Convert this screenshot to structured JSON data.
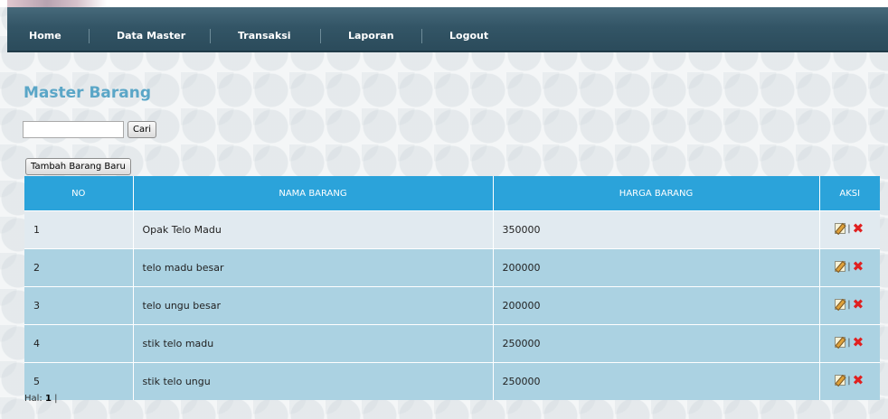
{
  "nav": {
    "items": [
      "Home",
      "Data Master",
      "Transaksi",
      "Laporan",
      "Logout"
    ]
  },
  "page": {
    "title": "Master Barang"
  },
  "search": {
    "value": "",
    "placeholder": "",
    "button": "Cari"
  },
  "add_button": "Tambah Barang Baru",
  "table": {
    "headers": [
      "NO",
      "NAMA BARANG",
      "HARGA BARANG",
      "AKSI"
    ],
    "rows": [
      {
        "no": "1",
        "name": "Opak Telo Madu",
        "price": "350000"
      },
      {
        "no": "2",
        "name": "telo madu besar",
        "price": "200000"
      },
      {
        "no": "3",
        "name": "telo ungu besar",
        "price": "200000"
      },
      {
        "no": "4",
        "name": "stik telo madu",
        "price": "250000"
      },
      {
        "no": "5",
        "name": "stik telo ungu",
        "price": "250000"
      }
    ],
    "action_separator": "|"
  },
  "pager": {
    "label": "Hal:",
    "current": "1",
    "trail": "|"
  },
  "colors": {
    "nav": "#335566",
    "header": "#2ba3da",
    "title": "#5aa6c7",
    "row_even": "#abd2e2",
    "row_odd": "#e1eaf0",
    "delete": "#e02020"
  },
  "icons": {
    "edit": "edit-icon",
    "delete": "delete-icon"
  }
}
